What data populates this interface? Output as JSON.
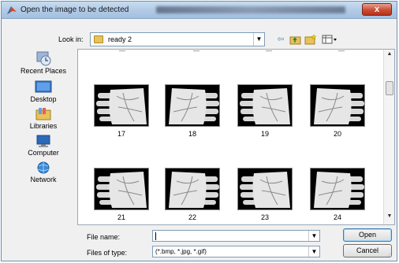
{
  "window": {
    "title": "Open the image to be detected",
    "close_label": "x"
  },
  "toolbar": {
    "look_in_label": "Look in:",
    "look_in_value": "ready 2",
    "icons": [
      "back-arrow-icon",
      "up-folder-icon",
      "new-folder-icon",
      "view-menu-icon"
    ]
  },
  "places": [
    {
      "label": "Recent Places",
      "icon": "recent-places-icon"
    },
    {
      "label": "Desktop",
      "icon": "desktop-icon"
    },
    {
      "label": "Libraries",
      "icon": "libraries-icon"
    },
    {
      "label": "Computer",
      "icon": "computer-icon"
    },
    {
      "label": "Network",
      "icon": "network-icon"
    }
  ],
  "files": [
    {
      "label": "17"
    },
    {
      "label": "18"
    },
    {
      "label": "19"
    },
    {
      "label": "20"
    },
    {
      "label": "21"
    },
    {
      "label": "22"
    },
    {
      "label": "23"
    },
    {
      "label": "24"
    }
  ],
  "form": {
    "file_name_label": "File name:",
    "file_name_value": "",
    "file_type_label": "Files of type:",
    "file_type_value": "(*.bmp, *.jpg, *.gif)",
    "open_label": "Open",
    "cancel_label": "Cancel"
  }
}
